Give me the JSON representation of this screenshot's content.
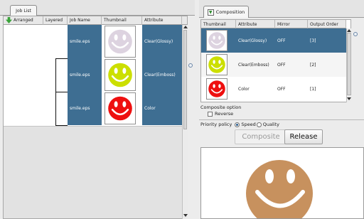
{
  "left_tabs": {
    "job_list": "Job List"
  },
  "left_header": {
    "arranged": "Arranged",
    "layered": "Layered",
    "job_name": "Job Name",
    "thumbnail": "Thumbnail",
    "attribute": "Attribute"
  },
  "jobs": [
    {
      "name": "smile.eps",
      "attribute": "Clear(Glossy)",
      "face_color": "#ddd3e0"
    },
    {
      "name": "smile.eps",
      "attribute": "Clear(Emboss)",
      "face_color": "#ccdf00"
    },
    {
      "name": "smile.eps",
      "attribute": "Color",
      "face_color": "#ee0f0f"
    }
  ],
  "right_tabs": {
    "composition": "Composition"
  },
  "comp_header": {
    "thumbnail": "Thumbnail",
    "attribute": "Attribute",
    "mirror": "Mirror",
    "output_order": "Output Order"
  },
  "comp_rows": [
    {
      "attribute": "Clear(Glossy)",
      "mirror": "OFF",
      "order": "[3]",
      "face_color": "#ddd3e0",
      "selected": true
    },
    {
      "attribute": "Clear(Emboss)",
      "mirror": "OFF",
      "order": "[2]",
      "face_color": "#ccdf00",
      "selected": false
    },
    {
      "attribute": "Color",
      "mirror": "OFF",
      "order": "[1]",
      "face_color": "#ee0f0f",
      "selected": false
    }
  ],
  "composite_option": {
    "label": "Composite option",
    "reverse": "Reverse"
  },
  "priority": {
    "label": "Priority policy",
    "speed": "Speed",
    "quality": "Quality",
    "selected": "Speed"
  },
  "buttons": {
    "composite": "Composite",
    "release": "Release"
  },
  "preview": {
    "face_color": "#c7915e"
  },
  "colors": {
    "selection": "#3e6e92",
    "accent_icon": "#3aa33a"
  }
}
